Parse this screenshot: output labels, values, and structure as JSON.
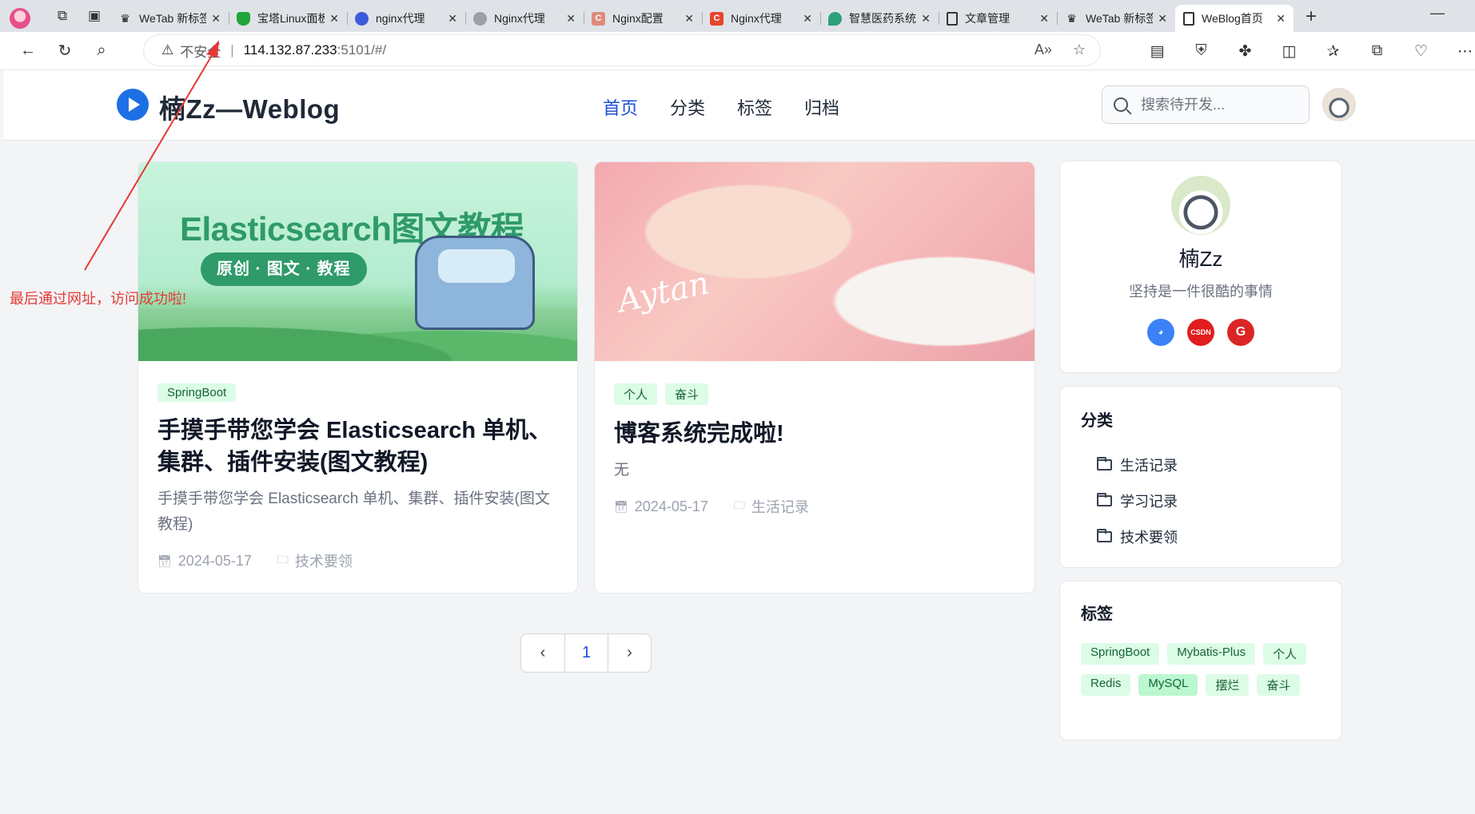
{
  "browser": {
    "tabs": [
      {
        "title": "",
        "favicon_color": "#e8508a",
        "favicon": "avatar"
      },
      {
        "title": "WeTab 新标签页",
        "favicon_color": "#111111",
        "favicon": "W"
      },
      {
        "title": "宝塔Linux面板",
        "favicon_color": "#20a53a",
        "favicon": "shield"
      },
      {
        "title": "nginx代理",
        "favicon_color": "#3b5bdb",
        "favicon": "paw"
      },
      {
        "title": "Nginx代理",
        "favicon_color": "#9aa0a6",
        "favicon": "g"
      },
      {
        "title": "Nginx配置",
        "favicon_color": "#e08a7b",
        "favicon": "C"
      },
      {
        "title": "Nginx代理",
        "favicon_color": "#e8442e",
        "favicon": "C"
      },
      {
        "title": "智慧医药系统",
        "favicon_color": "#2da07a",
        "favicon": "leaf"
      },
      {
        "title": "文章管理",
        "favicon_color": "#ffffff",
        "favicon": "doc"
      },
      {
        "title": "WeTab 新标签页",
        "favicon_color": "#111111",
        "favicon": "W"
      },
      {
        "title": "WeBlog首页",
        "favicon_color": "#ffffff",
        "favicon": "doc"
      }
    ],
    "address": {
      "security_label": "不安全",
      "host": "114.132.87.233",
      "path": ":5101/#/"
    }
  },
  "site": {
    "name": "楠Zz—Weblog",
    "nav": [
      "首页",
      "分类",
      "标签",
      "归档"
    ],
    "search_placeholder": "搜索待开发..."
  },
  "articles": [
    {
      "cover_title": "Elasticsearch图文教程",
      "cover_subtitle": "原创 · 图文 · 教程",
      "tags": [
        "SpringBoot"
      ],
      "title": "手摸手带您学会 Elasticsearch 单机、集群、插件安装(图文教程)",
      "description": "手摸手带您学会 Elasticsearch 单机、集群、插件安装(图文教程)",
      "date": "2024-05-17",
      "category": "技术要领"
    },
    {
      "cover_signature": "Aytan",
      "tags": [
        "个人",
        "奋斗"
      ],
      "title": "博客系统完成啦!",
      "description": "无",
      "date": "2024-05-17",
      "category": "生活记录"
    }
  ],
  "pagination": {
    "prev": "‹",
    "current": "1",
    "next": "›"
  },
  "profile": {
    "name": "楠Zz",
    "motto": "坚持是一件很酷的事情",
    "socials": [
      {
        "name": "github",
        "label": "",
        "color": "#3b82f6"
      },
      {
        "name": "csdn",
        "label": "CSDN",
        "color": "#e11d1d"
      },
      {
        "name": "gitee",
        "label": "G",
        "color": "#dc2626"
      }
    ]
  },
  "categories": {
    "title": "分类",
    "items": [
      "生活记录",
      "学习记录",
      "技术要领"
    ]
  },
  "tag_cloud": {
    "title": "标签",
    "items": [
      "SpringBoot",
      "Mybatis-Plus",
      "个人",
      "Redis",
      "MySQL",
      "摆烂",
      "奋斗"
    ]
  },
  "annotation": {
    "text": "最后通过网址，访问成功啦!",
    "color": "#e53935"
  }
}
